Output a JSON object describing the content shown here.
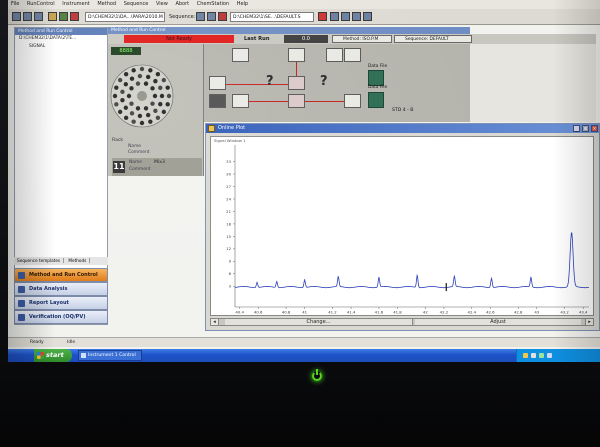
{
  "menu": [
    "File",
    "RunControl",
    "Instrument",
    "Method",
    "Sequence",
    "View",
    "Abort",
    "ChemStation",
    "Help"
  ],
  "toolbar": {
    "method_path": "D:\\CHEM32\\1\\DA...\\PARA\\2010.M",
    "sequence_label": "Sequence:",
    "sequence_path": "D:\\CHEM32\\1\\SE...\\DEFAULT.S"
  },
  "left_pane": {
    "title": "Method and Run Control",
    "tree": [
      {
        "label": "D:\\CHEM32\\1\\DATA\\2\\TE..."
      },
      {
        "label": "SIGNAL"
      }
    ],
    "tabs": [
      "Sequence templates",
      "Methods"
    ],
    "nav_buttons": [
      {
        "label": "Method and Run Control",
        "active": true
      },
      {
        "label": "Data Analysis",
        "active": false
      },
      {
        "label": "Report Layout",
        "active": false
      },
      {
        "label": "Verification (OQ/PV)",
        "active": false
      }
    ]
  },
  "main": {
    "title": "Method and Run Control",
    "status": "Not Ready",
    "last_run_label": "Last Run",
    "last_run_value": "0.0",
    "method_label": "Method:",
    "method_value": "ISO.P.M",
    "sequence_label": "Sequence:",
    "sequence_value": "DEFAULT"
  },
  "tray": {
    "counter": "8888",
    "rack_label": "Rack",
    "name_label": "Name",
    "comment_label": "Comment",
    "vial_number": "11",
    "vial_name": "Mix3"
  },
  "instrument": {
    "data_file_label": "Data File",
    "std_label": "STD 4 - B"
  },
  "plot": {
    "window_title": "Online Plot",
    "caption": "Signal Window 1",
    "change_button": "Change...",
    "adjust_button": "Adjust"
  },
  "chart_data": {
    "type": "line",
    "title": "",
    "xlabel": "",
    "ylabel": "",
    "xlim": [
      18.0,
      48.5
    ],
    "ylim": [
      -2,
      37
    ],
    "x_ticks": [
      18.4,
      20.0,
      22.4,
      24.0,
      26.4,
      28.0,
      30.4,
      32.0,
      34.4,
      36.0,
      38.4,
      40.0,
      42.4,
      44.0,
      46.4,
      48.0
    ],
    "x_tick_labels": [
      "40.4",
      "40.6",
      "40.8",
      "41",
      "41.2",
      "41.4",
      "41.6",
      "41.8",
      "42",
      "42.2",
      "42.4",
      "42.6",
      "42.8",
      "43",
      "43.2",
      "43.4"
    ],
    "y_ticks": [
      3,
      6,
      9,
      12,
      15,
      18,
      21,
      24,
      27,
      30,
      33
    ],
    "y_tick_labels": [
      "3",
      "6",
      "9",
      "12",
      "15",
      "18",
      "21",
      "24",
      "27",
      "30",
      "33"
    ],
    "baseline": 2.8,
    "peaks": [
      {
        "x": 19.9,
        "height": 1.2
      },
      {
        "x": 21.6,
        "height": 1.4
      },
      {
        "x": 24.0,
        "height": 1.8
      },
      {
        "x": 26.9,
        "height": 2.4
      },
      {
        "x": 30.4,
        "height": 2.3
      },
      {
        "x": 33.7,
        "height": 2.9
      },
      {
        "x": 36.9,
        "height": 2.5
      },
      {
        "x": 40.1,
        "height": 2.2
      },
      {
        "x": 43.5,
        "height": 2.3
      },
      {
        "x": 47.0,
        "height": 13.0
      }
    ],
    "marker_x": 36.2
  },
  "statusbar": {
    "items": [
      "Ready",
      "Idle"
    ]
  },
  "taskbar": {
    "start": "start",
    "task": "Instrument 1 Control",
    "clock": ""
  }
}
